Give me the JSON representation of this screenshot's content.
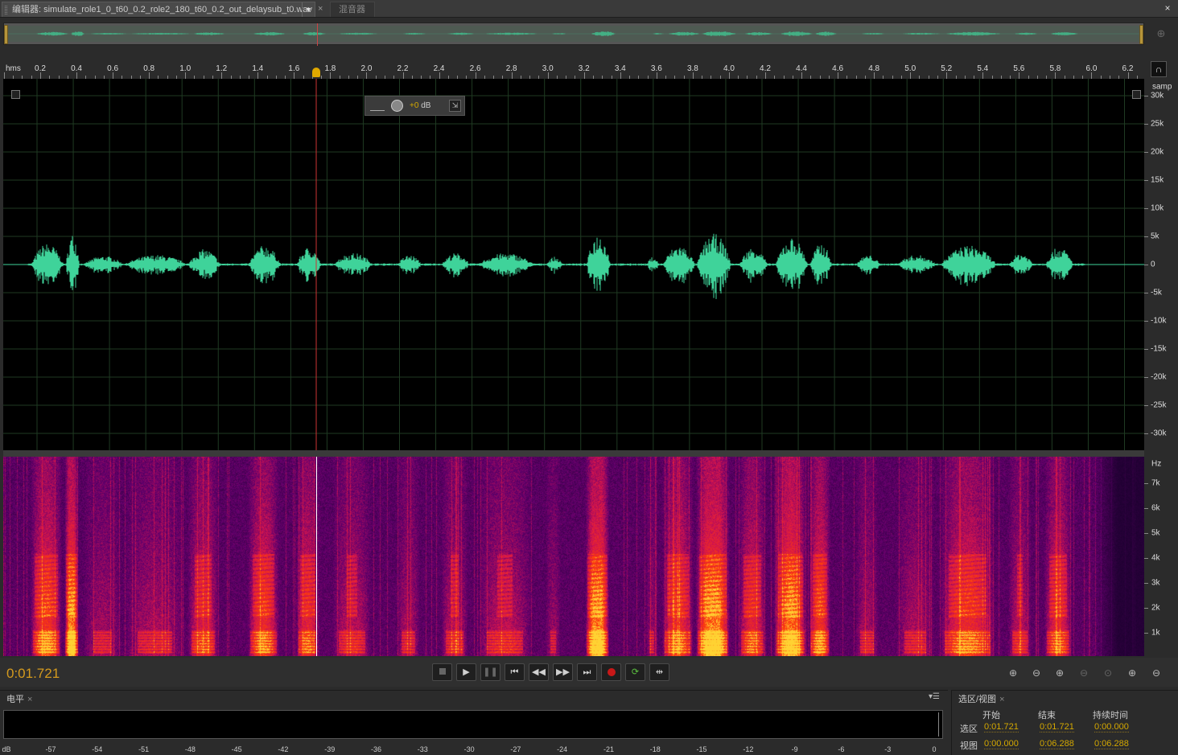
{
  "tabs": {
    "editor_label": "编辑器: simulate_role1_0_t60_0.2_role2_180_t60_0.2_out_delaysub_t0.wav",
    "editor_dropdown": "▼",
    "close_glyph": "×",
    "mixer_label": "混音器"
  },
  "window": {
    "close_glyph": "×"
  },
  "ruler": {
    "unit": "hms",
    "ticks": [
      "0.2",
      "0.4",
      "0.6",
      "0.8",
      "1.0",
      "1.2",
      "1.4",
      "1.6",
      "1.8",
      "2.0",
      "2.2",
      "2.4",
      "2.6",
      "2.8",
      "3.0",
      "3.2",
      "3.4",
      "3.6",
      "3.8",
      "4.0",
      "4.2",
      "4.4",
      "4.6",
      "4.8",
      "5.0",
      "5.2",
      "5.4",
      "5.6",
      "5.8",
      "6.0",
      "6.2"
    ]
  },
  "hud": {
    "gain_value": "+0",
    "gain_unit": "dB",
    "pin_glyph": "⇲"
  },
  "amplitude_scale": {
    "unit": "samp",
    "labels": [
      "30k",
      "25k",
      "20k",
      "15k",
      "10k",
      "5k",
      "0",
      "-5k",
      "-10k",
      "-15k",
      "-20k",
      "-25k",
      "-30k"
    ]
  },
  "frequency_scale": {
    "unit": "Hz",
    "labels": [
      "7k",
      "6k",
      "5k",
      "4k",
      "3k",
      "2k",
      "1k"
    ]
  },
  "transport": {
    "current_time": "0:01.721",
    "buttons": [
      "stop",
      "play",
      "pause",
      "previous",
      "rewind",
      "fast-forward",
      "next",
      "record",
      "loop",
      "skip-selection"
    ]
  },
  "zoom_controls": [
    "zoom-in-amplitude",
    "zoom-out-amplitude",
    "zoom-in-time",
    "zoom-out-time",
    "zoom-full",
    "zoom-in-selection",
    "zoom-out-selection"
  ],
  "levels_panel": {
    "title": "电平",
    "close_glyph": "×",
    "menu_glyph": "▾☰",
    "db_unit": "dB",
    "db_labels": [
      "-57",
      "-54",
      "-51",
      "-48",
      "-45",
      "-42",
      "-39",
      "-36",
      "-33",
      "-30",
      "-27",
      "-24",
      "-21",
      "-18",
      "-15",
      "-12",
      "-9",
      "-6",
      "-3",
      "0"
    ]
  },
  "selection_panel": {
    "title": "选区/视图",
    "close_glyph": "×",
    "col_start": "开始",
    "col_end": "结束",
    "col_duration": "持续时间",
    "row_selection": "选区",
    "row_view": "视图",
    "selection_start": "0:01.721",
    "selection_end": "0:01.721",
    "selection_duration": "0:00.000",
    "view_start": "0:00.000",
    "view_end": "0:06.288",
    "view_duration": "0:06.288"
  },
  "colors": {
    "waveform": "#3fd39a",
    "playhead": "#cc3333",
    "time_display": "#d49a1e",
    "accent_value": "#d4a800",
    "background": "#2b2b2b"
  }
}
